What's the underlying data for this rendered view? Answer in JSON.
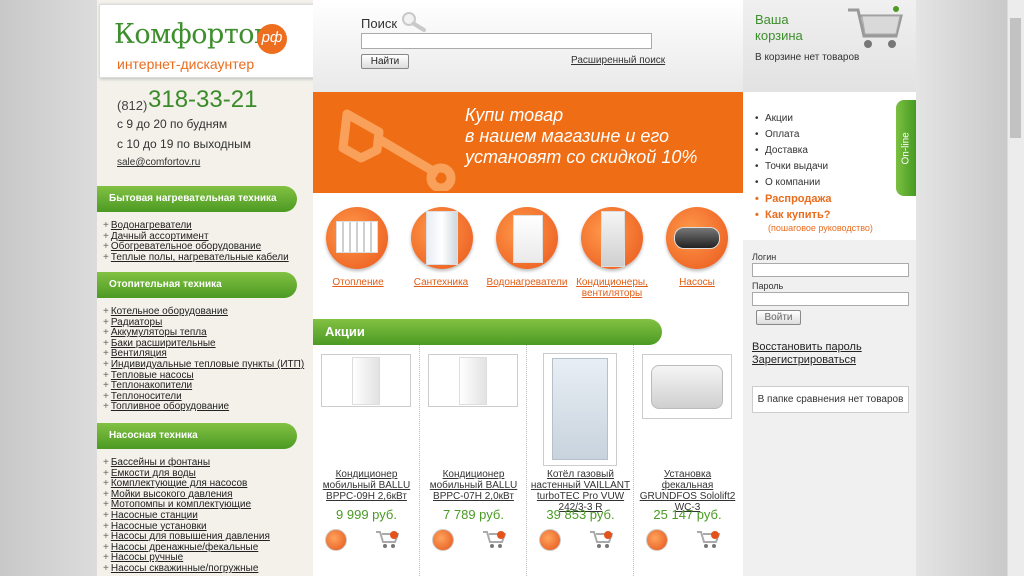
{
  "logo": {
    "name": "Комфортов",
    "rf": "рф",
    "tagline": "интернет-дискаунтер"
  },
  "contacts": {
    "phone_prefix": "(812)",
    "phone": "318-33-21",
    "hours_weekdays": "с 9 до 20 по будням",
    "hours_weekend": "с 10 до 19 по выходным",
    "email": "sale@comfortov.ru"
  },
  "categories": [
    {
      "title": "Бытовая нагревательная техника",
      "items": [
        "Водонагреватели",
        "Дачный ассортимент",
        "Обогревательное оборудование",
        "Теплые полы, нагревательные кабели"
      ]
    },
    {
      "title": "Отопительная техника",
      "items": [
        "Котельное оборудование",
        "Радиаторы",
        "Аккумуляторы тепла",
        "Баки расширительные",
        "Вентиляция",
        "Индивидуальные тепловые пункты (ИТП)",
        "Тепловые насосы",
        "Теплонакопители",
        "Теплоносители",
        "Топливное оборудование"
      ]
    },
    {
      "title": "Насосная техника",
      "items": [
        "Бассейны и фонтаны",
        "Емкости для воды",
        "Комплектующие для насосов",
        "Мойки высокого давления",
        "Мотопомпы и комплектующие",
        "Насосные станции",
        "Насосные установки",
        "Насосы для повышения давления",
        "Насосы дренажные/фекальные",
        "Насосы ручные",
        "Насосы скважинные/погружные"
      ]
    }
  ],
  "search": {
    "label": "Поиск",
    "button": "Найти",
    "advanced": "Расширенный поиск",
    "value": ""
  },
  "banner": {
    "line1": "Купи товар",
    "line2": "в нашем магазине и его",
    "line3": "установят со скидкой 10%"
  },
  "main_categories": [
    {
      "name": "Отопление",
      "icon": "radiator-icon"
    },
    {
      "name": "Сантехника",
      "icon": "shower-cabin-icon"
    },
    {
      "name": "Водонагреватели",
      "icon": "boiler-icon"
    },
    {
      "name": "Кондиционеры, вентиляторы",
      "icon": "air-conditioner-icon"
    },
    {
      "name": "Насосы",
      "icon": "pump-icon"
    }
  ],
  "promo": {
    "title": "Акции"
  },
  "products": [
    {
      "name": "Кондиционер мобильный BALLU BPPC-09H 2,6кВт",
      "price": "9 999 руб."
    },
    {
      "name": "Кондиционер мобильный BALLU BPPC-07H 2,0кВт",
      "price": "7 789 руб."
    },
    {
      "name": "Котёл газовый настенный VAILLANT turboTEC Pro VUW 242/3-3 R",
      "price": "39 853 руб."
    },
    {
      "name": "Установка фекальная GRUNDFOS Sololift2 WC-3",
      "price": "25 147 руб."
    }
  ],
  "cart": {
    "title1": "Ваша",
    "title2": "корзина",
    "empty": "В корзине нет товаров"
  },
  "info_menu": [
    "Акции",
    "Оплата",
    "Доставка",
    "Точки выдачи",
    "О компании",
    "Распродажа",
    "Как купить?"
  ],
  "howto_sub": "(пошаговое руководство)",
  "online": "On-line",
  "login": {
    "login_label": "Логин",
    "password_label": "Пароль",
    "button": "Войти",
    "restore": "Восстановить пароль",
    "register": "Зарегистрироваться"
  },
  "compare": "В папке сравнения нет товаров",
  "colors": {
    "green": "#4c9a23",
    "orange": "#ef6d14"
  }
}
